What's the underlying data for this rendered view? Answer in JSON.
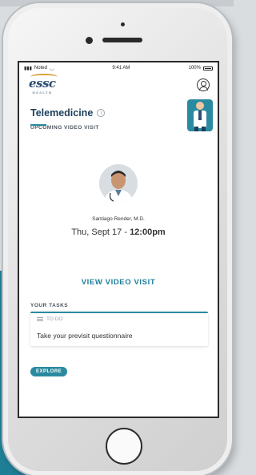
{
  "status_bar": {
    "carrier": "Noted",
    "time": "9:41 AM",
    "battery": "100%"
  },
  "app": {
    "logo_text": "essc",
    "logo_sub": "HEALTH"
  },
  "telemedicine": {
    "title": "Telemedicine",
    "info_glyph": "i",
    "upcoming_label": "UPCOMING VIDEO VISIT",
    "doctor_name": "Santiago Render, M.D.",
    "visit_date": "Thu, Sept 17 - ",
    "visit_time": "12:00pm",
    "view_button": "VIEW VIDEO VISIT"
  },
  "tasks": {
    "label": "YOUR TASKS",
    "todo_label": "TO DO",
    "item": "Take your previsit questionnaire",
    "explore_button": "EXPLORE"
  },
  "colors": {
    "accent": "#2a8aa0",
    "title": "#1d3f5b",
    "background_teal": "#1f7f96"
  },
  "icons": [
    "signal-icon",
    "wifi-icon",
    "battery-icon",
    "profile-icon",
    "info-icon",
    "doctor-illustration",
    "list-icon"
  ]
}
